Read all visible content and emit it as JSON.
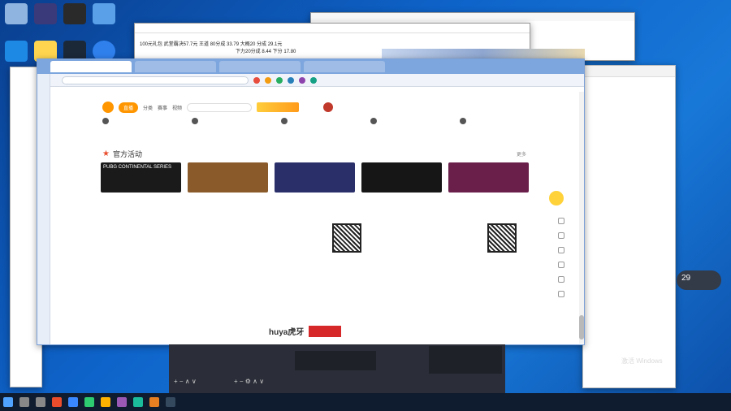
{
  "desktop": {
    "icons": [
      "",
      "",
      "",
      ""
    ],
    "side_icons": [
      "",
      ""
    ]
  },
  "notepad": {
    "title": "",
    "menu": "",
    "line1": "100元礼包  武堂霸决57.7元    王道    80分成 33.79    大概20 分成 29.1元",
    "line2": "下力20分成 8.44    下分 17.80"
  },
  "explorer": {
    "title": ""
  },
  "browser": {
    "tabs": [
      "",
      "",
      "",
      ""
    ],
    "address": "",
    "site_nav": {
      "home_button": "直播",
      "items": [
        "分类",
        "赛事",
        "视频"
      ],
      "search_placeholder": "",
      "promo": "",
      "actions": [
        "",
        "",
        "",
        ""
      ],
      "user": ""
    },
    "tags": [
      "",
      "",
      "",
      "",
      ""
    ],
    "section_title": "官方活动",
    "more_label": "更多",
    "thumbnails": [
      {
        "label": "PUBG CONTINENTAL SERIES",
        "color": "#1a1a1a"
      },
      {
        "label": "",
        "color": "#8a5a2a"
      },
      {
        "label": "",
        "color": "#2a2f6a"
      },
      {
        "label": "",
        "color": "#161616"
      },
      {
        "label": "",
        "color": "#6a1f4a"
      }
    ],
    "footer": {
      "col1_title": "",
      "col1_items": [
        "",
        "",
        "",
        ""
      ],
      "col2_title": "",
      "col2_items": [
        "",
        "",
        "",
        ""
      ],
      "col3_title": "",
      "col3_items": [
        "",
        "",
        "",
        ""
      ],
      "app_title": "",
      "app_items": [
        "",
        "",
        "",
        "",
        ""
      ],
      "wechat_title": "",
      "wechat_items": [
        "",
        "",
        ""
      ],
      "links": "",
      "brand": "huya虎牙"
    }
  },
  "obs": {
    "controls_left": "+ − ∧ ∨",
    "controls_mid": "+ − ⚙ ∧ ∨",
    "buttons": [
      "",
      "",
      ""
    ]
  },
  "widget": {
    "temp": "29"
  },
  "activation": {
    "line1": "激活 Windows",
    "line2": ""
  },
  "taskbar": {
    "time": "",
    "date": ""
  }
}
